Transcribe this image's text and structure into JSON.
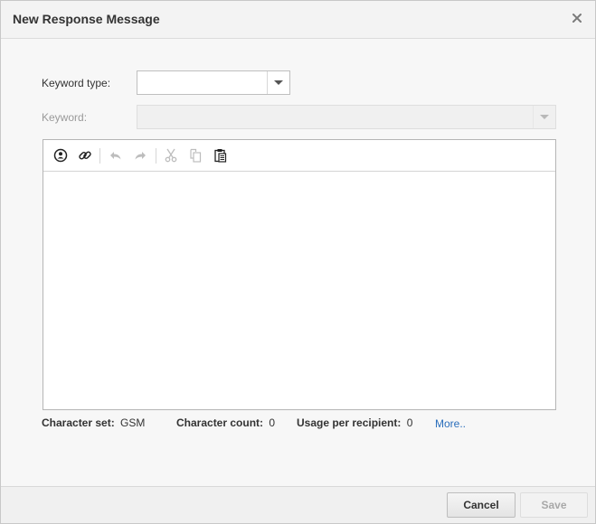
{
  "dialog": {
    "title": "New Response Message"
  },
  "form": {
    "keyword_type_label": "Keyword type:",
    "keyword_type_value": "",
    "keyword_label": "Keyword:",
    "keyword_value": ""
  },
  "editor": {
    "toolbar": [
      {
        "name": "insert-field-icon",
        "enabled": true
      },
      {
        "name": "link-icon",
        "enabled": true
      },
      {
        "name": "undo-icon",
        "enabled": false
      },
      {
        "name": "redo-icon",
        "enabled": false
      },
      {
        "name": "cut-icon",
        "enabled": false
      },
      {
        "name": "copy-icon",
        "enabled": false
      },
      {
        "name": "paste-icon",
        "enabled": true
      }
    ],
    "content": ""
  },
  "status": {
    "charset_label": "Character set:",
    "charset_value": "GSM",
    "count_label": "Character count:",
    "count_value": "0",
    "usage_label": "Usage per recipient:",
    "usage_value": "0",
    "more_link": "More.."
  },
  "footer": {
    "cancel_label": "Cancel",
    "save_label": "Save"
  },
  "colors": {
    "link": "#2a6ebb",
    "disabled_text": "#a8a8a8"
  }
}
